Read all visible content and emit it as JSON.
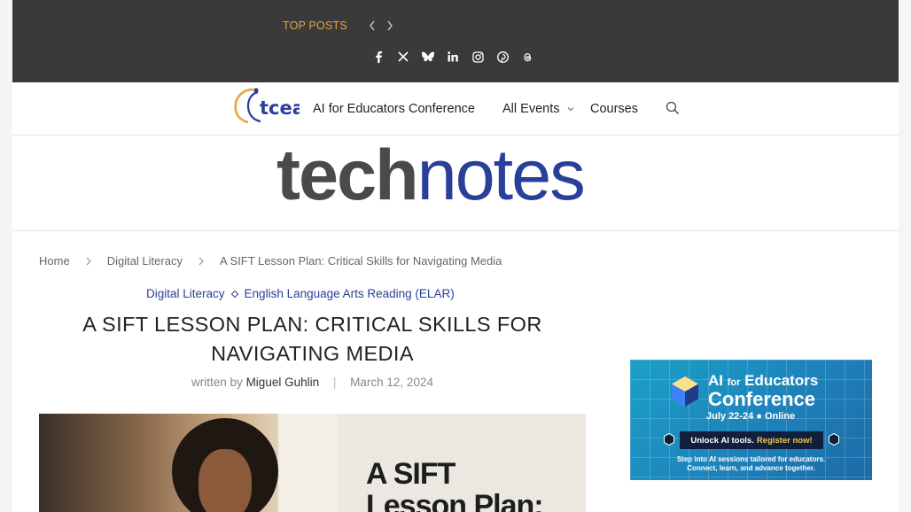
{
  "topbar": {
    "top_posts_label": "TOP POSTS",
    "prev_icon": "chevron-left-icon",
    "next_icon": "chevron-right-icon",
    "social_icons": [
      "facebook-icon",
      "x-icon",
      "bluesky-icon",
      "linkedin-icon",
      "instagram-icon",
      "pinterest-icon",
      "threads-icon"
    ]
  },
  "nav": {
    "logo_text": "tcea",
    "items": [
      "AI for Educators Conference",
      "All Events",
      "Courses"
    ],
    "search_icon": "search-icon"
  },
  "masthead": {
    "brand_bold": "tech",
    "brand_light": "notes"
  },
  "breadcrumb": {
    "home": "Home",
    "category": "Digital Literacy",
    "current": "A SIFT Lesson Plan: Critical Skills for Navigating Media"
  },
  "article": {
    "categories": [
      "Digital Literacy",
      "English Language Arts Reading (ELAR)"
    ],
    "title": "A SIFT LESSON PLAN: CRITICAL SKILLS FOR NAVIGATING MEDIA",
    "written_by": "written by",
    "author": "Miguel Guhlin",
    "date": "March 12, 2024",
    "image_text_line1": "A SIFT",
    "image_text_line2": "Lesson Plan:"
  },
  "ad": {
    "line1_a": "AI",
    "line1_b": "for",
    "line1_c": "Educators",
    "line2": "Conference",
    "date": "July 22-24  ●  Online",
    "button_a": "Unlock AI tools.",
    "button_b": "Register now!",
    "sub1": "Step into AI sessions tailored for educators.",
    "sub2": "Connect, learn, and advance together."
  },
  "colors": {
    "accent_orange": "#e8a33d",
    "brand_blue": "#2a3f99",
    "topbar": "#3a3a3a"
  }
}
